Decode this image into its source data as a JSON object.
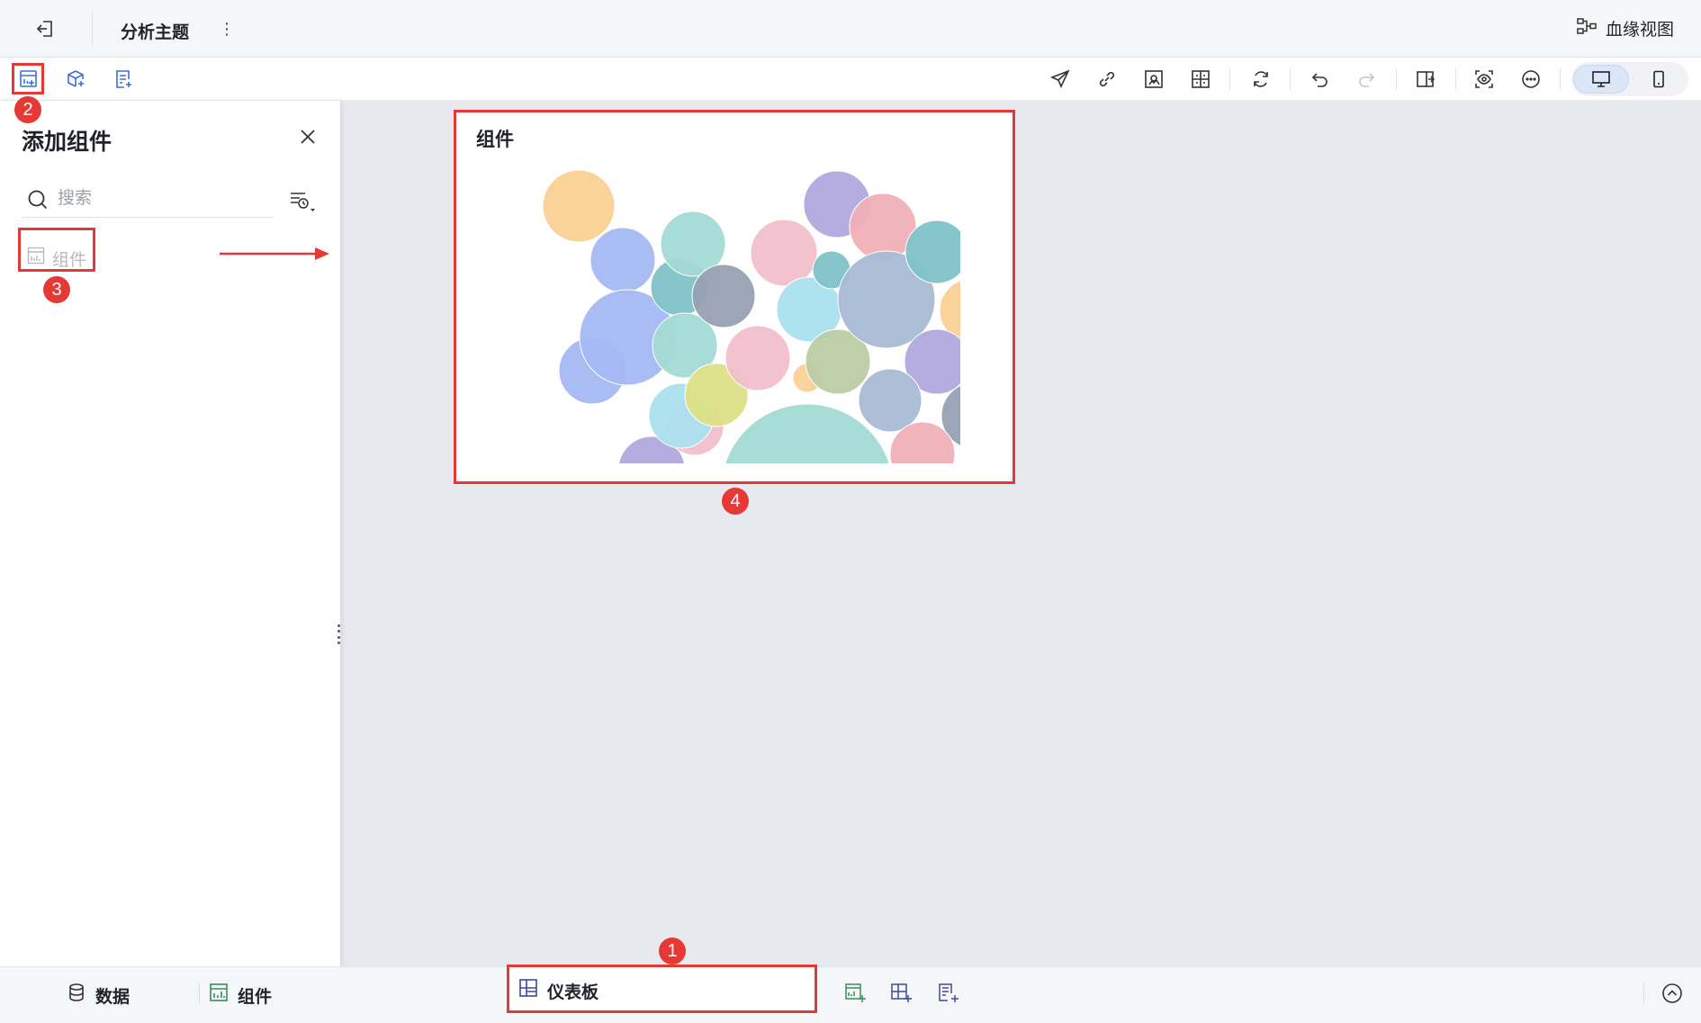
{
  "header": {
    "title": "分析主题",
    "lineage_label": "血缘视图",
    "icons": [
      "exit-icon",
      "more-vertical-icon",
      "lineage-icon"
    ]
  },
  "toolbar": {
    "left_icons": [
      "add-chart-icon",
      "add-model-icon",
      "add-report-icon"
    ],
    "right_icons": [
      "send-icon",
      "link-icon",
      "screenshot-icon",
      "layout-icon",
      "refresh-icon",
      "undo-icon",
      "redo-icon",
      "export-icon",
      "preview-icon",
      "more-icon",
      "desktop-icon",
      "mobile-icon"
    ]
  },
  "panel": {
    "title": "添加组件",
    "search_placeholder": "搜索",
    "item_label": "组件"
  },
  "canvas": {
    "card_title": "组件",
    "bubble_colors": [
      "#a4b8f3",
      "#a3dad4",
      "#f1bfcb",
      "#b1a8de",
      "#7fc2c7",
      "#f9d193",
      "#97a1b3",
      "#abe0ee",
      "#a9bbd5",
      "#bccca5",
      "#dde086",
      "#f0b0b7"
    ]
  },
  "footer": {
    "data_label": "数据",
    "component_label": "组件",
    "dashboard_label": "仪表板"
  },
  "annotations": {
    "badges": [
      "1",
      "2",
      "3",
      "4"
    ]
  },
  "colors": {
    "accent": "#3b6fd6",
    "annotation_red": "#e53935"
  }
}
